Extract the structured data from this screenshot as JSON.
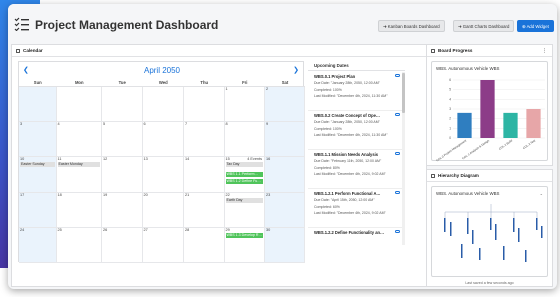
{
  "header": {
    "title": "Project Management Dashboard",
    "buttons": [
      "Kanban Boards Dashboard",
      "Gantt Charts Dashboard",
      "Add Widget"
    ]
  },
  "calendar_panel": {
    "title": "Calendar",
    "month": "April 2050",
    "days_of_week": [
      "Sun",
      "Mon",
      "Tue",
      "Wed",
      "Thu",
      "Fri",
      "Sat"
    ],
    "weeks": [
      [
        "",
        "",
        "",
        "",
        "",
        "1",
        "2"
      ],
      [
        "3",
        "4",
        "5",
        "6",
        "7",
        "8",
        "9"
      ],
      [
        "10",
        "11",
        "12",
        "13",
        "14",
        "15",
        "16"
      ],
      [
        "17",
        "18",
        "19",
        "20",
        "21",
        "22",
        "23"
      ],
      [
        "24",
        "25",
        "26",
        "27",
        "28",
        "29",
        "30"
      ]
    ],
    "events": {
      "easter_sunday": "Easter Sunday",
      "easter_monday": "Easter Monday",
      "more_events": "4 Events",
      "tax_day": "Tax Day",
      "task1": "WBS 1.1 Perform…",
      "task2": "WBS 1.2 Define Fu…",
      "earth_day": "Earth Day",
      "task3": "WBS 1.3 Develop R…"
    }
  },
  "upcoming": {
    "title": "Upcoming Dates",
    "items": [
      {
        "title": "WBS.0.1 Project Plan",
        "due": "Due Date: \"January 28th, 2050, 12:00 AM\"",
        "completed": "Completed: 100%",
        "modified": "Last Modified: \"December 4th, 2024, 11:30 AM\""
      },
      {
        "title": "WBS.0.2 Create Concept of Ope…",
        "due": "Due Date: \"January 28th, 2050, 12:00 AM\"",
        "completed": "Completed: 100%",
        "modified": "Last Modified: \"December 4th, 2024, 11:30 AM\""
      },
      {
        "title": "WBS.1.1 Mission Needs Analysis",
        "due": "Due Date: \"February 11th, 2050, 12:00 AM\"",
        "completed": "Completed: 80%",
        "modified": "Last Modified: \"December 4th, 2024, 9:02 AM\""
      },
      {
        "title": "WBS.1.2.1 Perform Functional A…",
        "due": "Due Date: \"April 15th, 2050, 12:00 AM\"",
        "completed": "Completed: 60%",
        "modified": "Last Modified: \"December 4th, 2024, 9:02 AM\""
      },
      {
        "title": "WBS.1.2.2 Define Functionality an…",
        "due": "",
        "completed": "",
        "modified": ""
      }
    ]
  },
  "board_progress": {
    "title": "Board Progress",
    "selector": "WBS. Autonomous Vehicle WBS"
  },
  "chart_data": {
    "type": "bar",
    "categories": [
      "COL.0 Project Management",
      "COL.1 Analysis & Design",
      "COL.2 Build",
      "COL.3 Test"
    ],
    "values": [
      2.6,
      6,
      2.6,
      3
    ],
    "colors": [
      "#2f7ec0",
      "#8c3c88",
      "#2db5a4",
      "#e7a6a8"
    ],
    "ylim": [
      0,
      6
    ],
    "yticks": [
      "0",
      "1",
      "2",
      "3",
      "4",
      "5",
      "6"
    ]
  },
  "hierarchy": {
    "title": "Hierarchy Diagram",
    "selector": "WBS. Autonomous Vehicle WBS",
    "status": "Last saved a few seconds ago"
  }
}
